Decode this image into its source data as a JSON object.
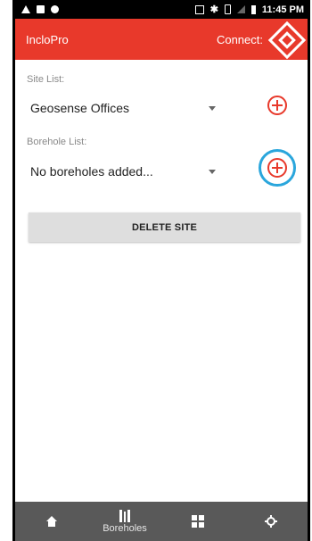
{
  "status_bar": {
    "time": "11:45 PM"
  },
  "app_bar": {
    "title": "IncloPro",
    "connect_label": "Connect:"
  },
  "site_section": {
    "label": "Site List:",
    "selected": "Geosense Offices"
  },
  "borehole_section": {
    "label": "Borehole List:",
    "selected": "No boreholes added..."
  },
  "delete_button": {
    "label": "DELETE SITE"
  },
  "bottom_nav": {
    "items": [
      {
        "icon": "home-icon",
        "label": ""
      },
      {
        "icon": "boreholes-icon",
        "label": "Boreholes"
      },
      {
        "icon": "grid-icon",
        "label": ""
      },
      {
        "icon": "gear-icon",
        "label": ""
      }
    ]
  },
  "colors": {
    "accent": "#e8392b",
    "highlight": "#2aa6dc",
    "nav_bg": "#595959"
  }
}
